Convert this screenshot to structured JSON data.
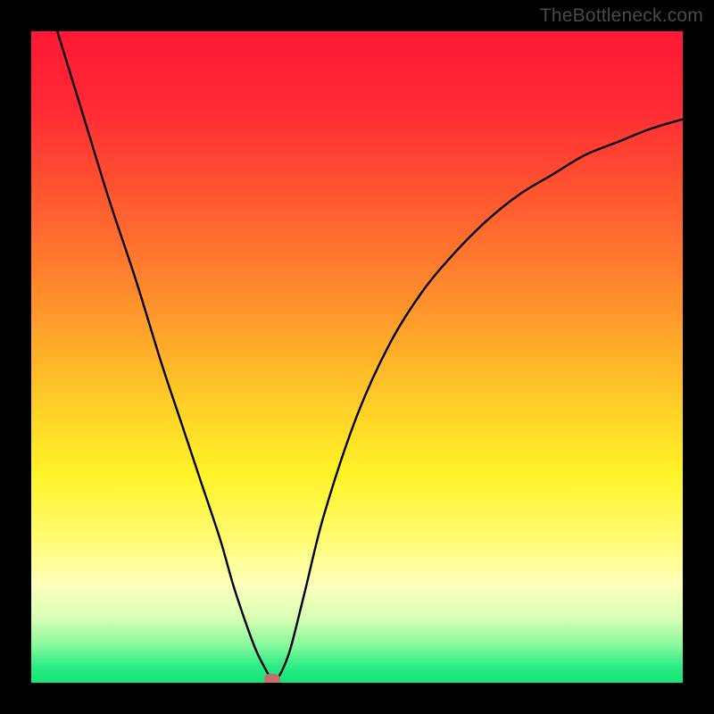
{
  "watermark": "TheBottleneck.com",
  "chart_data": {
    "type": "line",
    "title": "",
    "xlabel": "",
    "ylabel": "",
    "xlim": [
      0,
      100
    ],
    "ylim": [
      0,
      100
    ],
    "x": [
      4,
      8,
      12,
      16,
      20,
      23,
      26,
      29,
      31,
      33,
      34.5,
      36,
      37,
      38,
      39,
      40,
      42,
      45,
      50,
      55,
      60,
      65,
      70,
      75,
      80,
      85,
      90,
      95,
      100
    ],
    "values": [
      100,
      87,
      74,
      62,
      49,
      40,
      31,
      22,
      15,
      9,
      5,
      2,
      0.5,
      1,
      3,
      6,
      14,
      26,
      41,
      52,
      60,
      66,
      71,
      75,
      78,
      81,
      83,
      85,
      86.5
    ],
    "gradient_stops": [
      {
        "pos": 0.0,
        "color": "#ff1836"
      },
      {
        "pos": 0.12,
        "color": "#ff2b34"
      },
      {
        "pos": 0.25,
        "color": "#ff5630"
      },
      {
        "pos": 0.4,
        "color": "#ff8b2d"
      },
      {
        "pos": 0.55,
        "color": "#ffc629"
      },
      {
        "pos": 0.68,
        "color": "#fff327"
      },
      {
        "pos": 0.78,
        "color": "#fffc72"
      },
      {
        "pos": 0.85,
        "color": "#fdffbb"
      },
      {
        "pos": 0.9,
        "color": "#d8ffb4"
      },
      {
        "pos": 0.94,
        "color": "#8ef99f"
      },
      {
        "pos": 0.975,
        "color": "#2bed86"
      },
      {
        "pos": 1.0,
        "color": "#14e47a"
      }
    ],
    "marker": {
      "x": 37,
      "y": 0.5,
      "color": "#c96d6a"
    }
  }
}
